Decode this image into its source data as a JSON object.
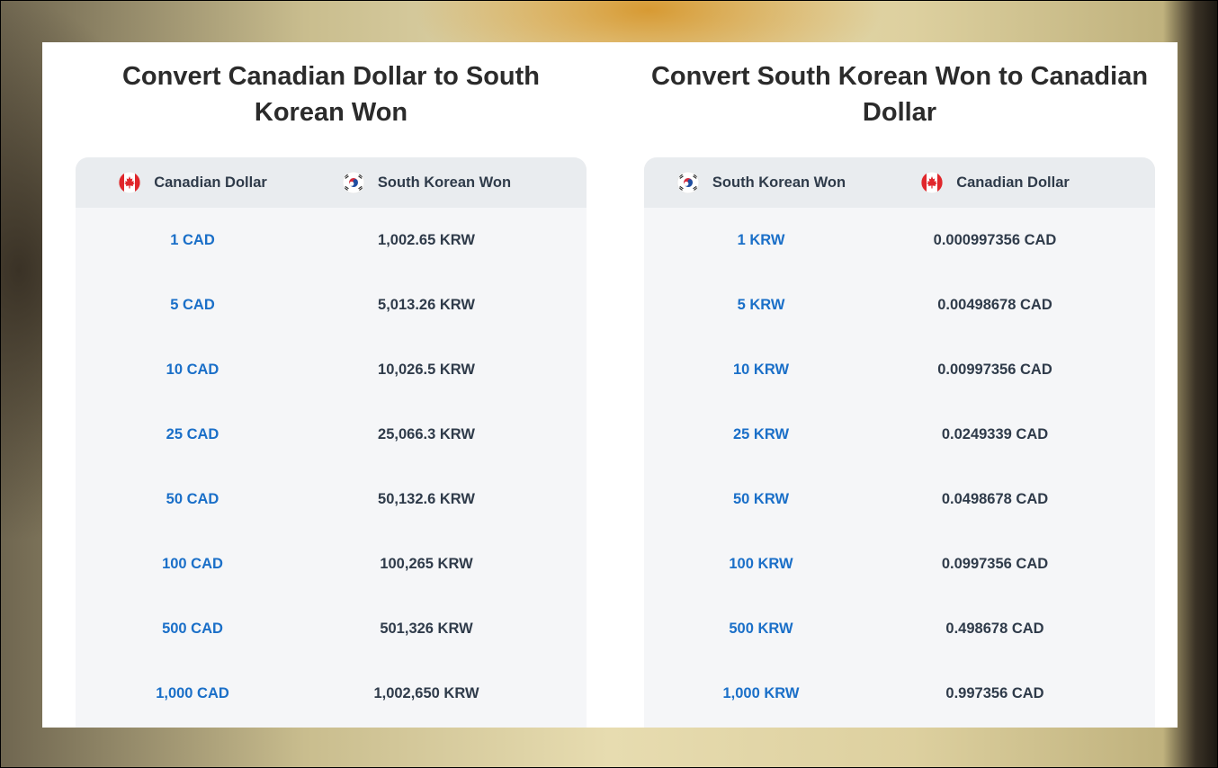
{
  "left_section": {
    "title": "Convert Canadian Dollar to South Korean Won",
    "header": {
      "from_currency": "Canadian Dollar",
      "to_currency": "South Korean Won"
    },
    "rows": [
      {
        "amount": "1 CAD",
        "converted": "1,002.65 KRW"
      },
      {
        "amount": "5 CAD",
        "converted": "5,013.26 KRW"
      },
      {
        "amount": "10 CAD",
        "converted": "10,026.5 KRW"
      },
      {
        "amount": "25 CAD",
        "converted": "25,066.3 KRW"
      },
      {
        "amount": "50 CAD",
        "converted": "50,132.6 KRW"
      },
      {
        "amount": "100 CAD",
        "converted": "100,265 KRW"
      },
      {
        "amount": "500 CAD",
        "converted": "501,326 KRW"
      },
      {
        "amount": "1,000 CAD",
        "converted": "1,002,650 KRW"
      }
    ]
  },
  "right_section": {
    "title": "Convert South Korean Won to Canadian Dollar",
    "header": {
      "from_currency": "South Korean Won",
      "to_currency": "Canadian Dollar"
    },
    "rows": [
      {
        "amount": "1 KRW",
        "converted": "0.000997356 CAD"
      },
      {
        "amount": "5 KRW",
        "converted": "0.00498678 CAD"
      },
      {
        "amount": "10 KRW",
        "converted": "0.00997356 CAD"
      },
      {
        "amount": "25 KRW",
        "converted": "0.0249339 CAD"
      },
      {
        "amount": "50 KRW",
        "converted": "0.0498678 CAD"
      },
      {
        "amount": "100 KRW",
        "converted": "0.0997356 CAD"
      },
      {
        "amount": "500 KRW",
        "converted": "0.498678 CAD"
      },
      {
        "amount": "1,000 KRW",
        "converted": "0.997356 CAD"
      }
    ]
  },
  "icons": {
    "canada_flag": "canada-flag-icon",
    "korea_flag": "south-korea-flag-icon"
  },
  "colors": {
    "link": "#1a6fc8",
    "value_text": "#2f3b4a",
    "title_text": "#2b2b2b",
    "table_header_bg": "#e9ecef",
    "table_body_bg": "#f5f6f8"
  }
}
